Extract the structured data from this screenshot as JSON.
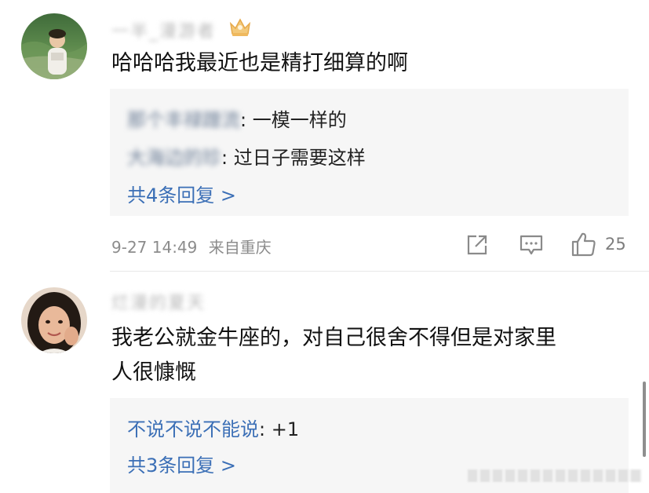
{
  "comments": [
    {
      "username_masked": "一半_漫游者",
      "text": "哈哈哈我最近也是精打细算的啊",
      "replies": [
        {
          "author_masked": "那个丰禄蹭流",
          "text": ": 一模一样的"
        },
        {
          "author_masked": "大海边的珍",
          "text": ": 过日子需要这样"
        }
      ],
      "more_replies": "共4条回复 >",
      "date": "9-27 14:49",
      "location": "来自重庆",
      "likes": "25"
    },
    {
      "username_masked": "烂漫的夏天",
      "text_lines": [
        "我老公就金牛座的，对自己很舍不得但是对家里",
        "人很慷慨"
      ],
      "replies": [
        {
          "author": "不说不说不能说",
          "text": ": +1"
        }
      ],
      "more_replies": "共3条回复 >"
    }
  ],
  "icons": {
    "share": "share-icon",
    "comment": "comment-icon",
    "like": "thumbs-up-icon",
    "crown": "crown-badge-icon"
  },
  "colors": {
    "link": "#3b6fb6",
    "meta": "#8c8c8c",
    "reply_bg": "#f6f6f6"
  }
}
